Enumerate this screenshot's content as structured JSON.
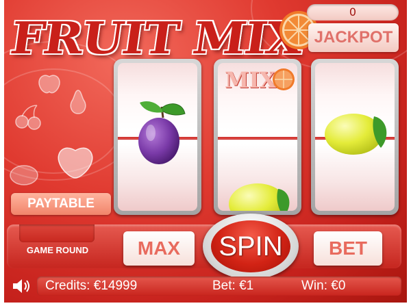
{
  "game": {
    "title": "FRUIT MIX"
  },
  "jackpot": {
    "value": "0",
    "label": "JACKPOT"
  },
  "reels": [
    {
      "symbols": [
        "plum"
      ]
    },
    {
      "symbols": [
        "mix-logo",
        "lemon"
      ],
      "logo_text": "MIX"
    },
    {
      "symbols": [
        "lemon"
      ]
    }
  ],
  "buttons": {
    "paytable": "PAYTABLE",
    "max": "MAX",
    "spin": "SPIN",
    "bet": "BET"
  },
  "game_round": {
    "label": "GAME ROUND"
  },
  "status": {
    "credits": "Credits: €14999",
    "bet": "Bet: €1",
    "win": "Win: €0"
  },
  "colors": {
    "background_red": "#d52a22",
    "accent_salmon": "#e86b5e",
    "plum_purple": "#7a3aa8",
    "lemon_yellow": "#e4ec3a",
    "leaf_green": "#3d9a2a",
    "orange": "#f07a2a"
  },
  "icons": {
    "sound": "speaker-icon"
  }
}
